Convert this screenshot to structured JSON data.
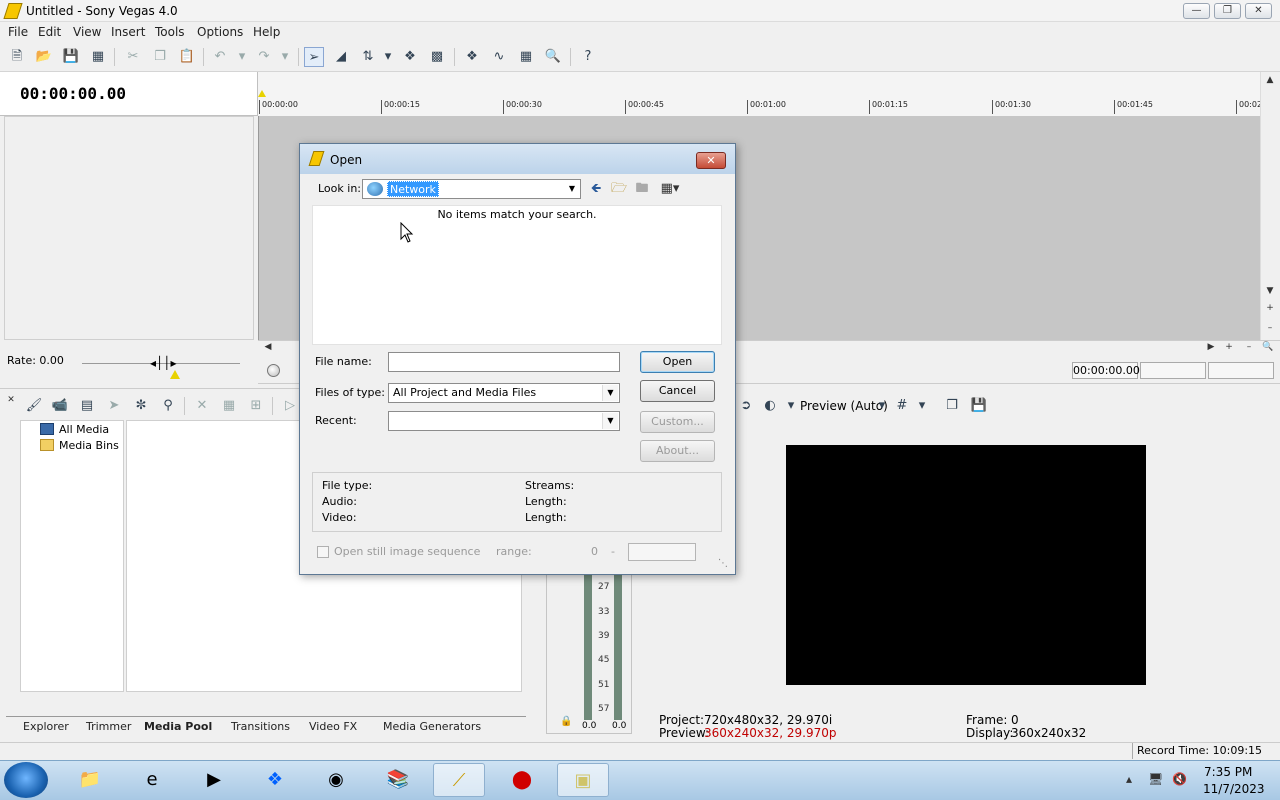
{
  "window": {
    "title": "Untitled - Sony Vegas 4.0"
  },
  "menu": [
    "File",
    "Edit",
    "View",
    "Insert",
    "Tools",
    "Options",
    "Help"
  ],
  "toolbar": {
    "buttons": [
      "new-file",
      "open-file",
      "save",
      "properties",
      "cut",
      "copy",
      "paste",
      "undo",
      "redo",
      "normal-edit-tool",
      "envelope-tool",
      "selection-tool",
      "snapping",
      "auto-crossfade",
      "enable-ripple",
      "lock-envelopes",
      "ignore-grouping",
      "zoom-tool",
      "whats-this-help"
    ]
  },
  "timeline": {
    "cursor_time": "00:00:00.00",
    "ruler_ticks": [
      "00:00:00",
      "00:00:15",
      "00:00:30",
      "00:00:45",
      "00:01:00",
      "00:01:15",
      "00:01:30",
      "00:01:45",
      "00:02"
    ],
    "rate_label": "Rate: 0.00",
    "transport_time": "00:00:00.00"
  },
  "media_pool": {
    "tree": [
      "All Media",
      "Media Bins"
    ],
    "tabs": [
      {
        "label": "Explorer",
        "active": false
      },
      {
        "label": "Trimmer",
        "active": false
      },
      {
        "label": "Media Pool",
        "active": true
      },
      {
        "label": "Transitions",
        "active": false
      },
      {
        "label": "Video FX",
        "active": false
      },
      {
        "label": "Media Generators",
        "active": false
      }
    ]
  },
  "meters": {
    "scale": [
      "27",
      "33",
      "39",
      "45",
      "51",
      "57"
    ],
    "left_value": "0.0",
    "right_value": "0.0"
  },
  "preview": {
    "mode_label": "Preview (Auto)",
    "project_label": "Project:",
    "project_value": "720x480x32, 29.970i",
    "preview_label": "Preview:",
    "preview_value": "360x240x32, 29.970p",
    "frame_label": "Frame:",
    "frame_value": "0",
    "display_label": "Display:",
    "display_value": "360x240x32"
  },
  "status": {
    "record_time": "Record Time: 10:09:15"
  },
  "taskbar": {
    "apps": [
      "windows-explorer",
      "internet-explorer",
      "media-player",
      "dropbox",
      "chrome",
      "winrar",
      "sony-vegas",
      "screen-recorder",
      "sticky-notes"
    ],
    "time": "7:35 PM",
    "date": "11/7/2023"
  },
  "dialog": {
    "title": "Open",
    "look_in_label": "Look in:",
    "look_in_value": "Network",
    "empty_message": "No items match your search.",
    "file_name_label": "File name:",
    "file_name_value": "",
    "files_of_type_label": "Files of type:",
    "files_of_type_value": "All Project and Media Files",
    "recent_label": "Recent:",
    "recent_value": "",
    "buttons": {
      "open": "Open",
      "cancel": "Cancel",
      "custom": "Custom...",
      "about": "About..."
    },
    "info": {
      "file_type_label": "File type:",
      "audio_label": "Audio:",
      "video_label": "Video:",
      "streams_label": "Streams:",
      "length_label_1": "Length:",
      "length_label_2": "Length:"
    },
    "sequence": {
      "checkbox_label": "Open still image sequence",
      "range_label": "range:",
      "range_start": "0",
      "range_dash": "-"
    }
  }
}
